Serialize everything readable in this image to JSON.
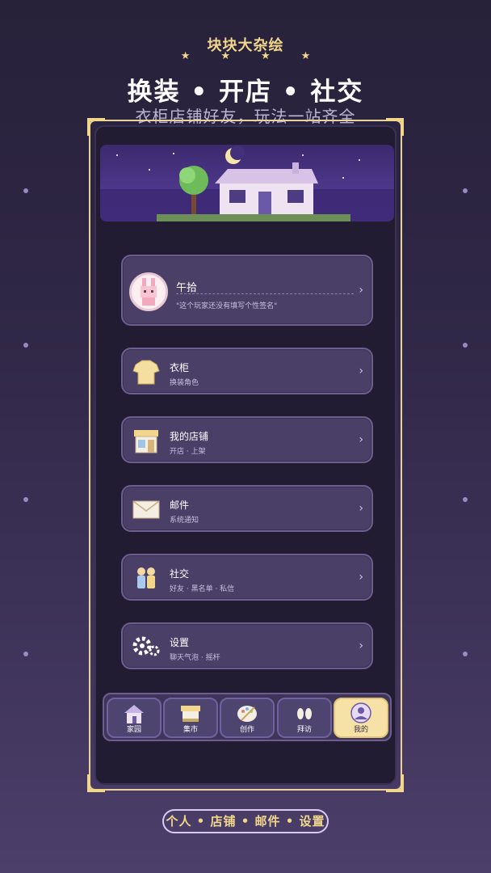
{
  "header": {
    "brand": "块块大杂绘",
    "headline": "换装 • 开店 • 社交",
    "subline": "衣柜店铺好友，玩法一站齐全"
  },
  "profile": {
    "name": "午拾",
    "signature": "\"这个玩家还没有填写个性签名\""
  },
  "menu": [
    {
      "title": "衣柜",
      "subtitle": "换装角色",
      "icon": "shirt-icon"
    },
    {
      "title": "我的店铺",
      "subtitle": "开店 · 上架",
      "icon": "shop-icon"
    },
    {
      "title": "邮件",
      "subtitle": "系统通知",
      "icon": "mail-icon"
    },
    {
      "title": "社交",
      "subtitle": "好友 · 黑名单 · 私信",
      "icon": "friends-icon"
    },
    {
      "title": "设置",
      "subtitle": "聊天气泡 · 摇杆",
      "icon": "gear-icon"
    }
  ],
  "tabs": [
    {
      "label": "家园",
      "icon": "house-icon",
      "active": false
    },
    {
      "label": "集市",
      "icon": "market-icon",
      "active": false
    },
    {
      "label": "创作",
      "icon": "palette-icon",
      "active": false
    },
    {
      "label": "拜访",
      "icon": "footprints-icon",
      "active": false
    },
    {
      "label": "我的",
      "icon": "user-icon",
      "active": true
    }
  ],
  "footer": {
    "caption": "个人 • 店铺 • 邮件 • 设置"
  },
  "colors": {
    "accent_gold": "#f1d68c",
    "card_bg": "#4a3f66",
    "screen_bg": "#221c33"
  }
}
